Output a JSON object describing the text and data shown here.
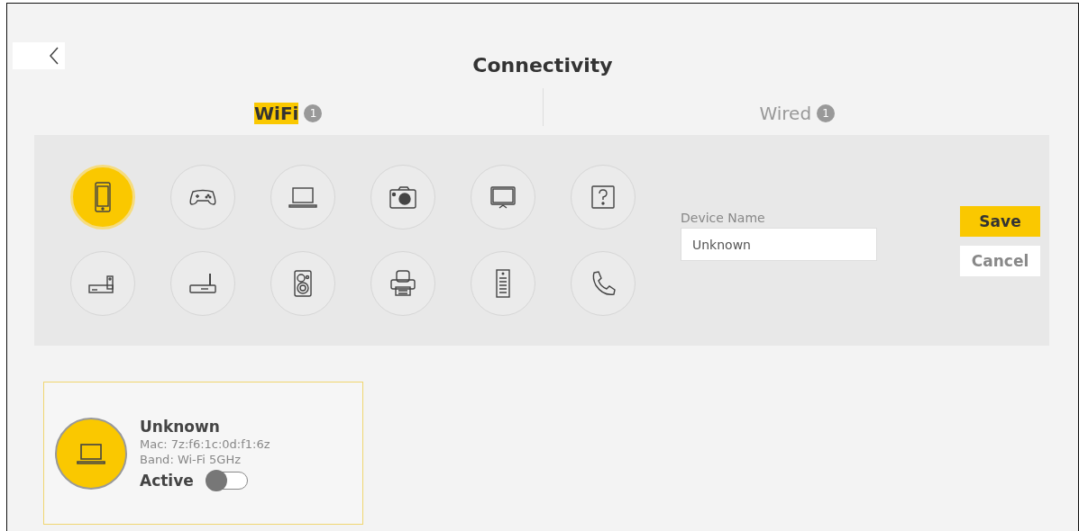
{
  "title": "Connectivity",
  "tabs": [
    {
      "label": "WiFi",
      "count": "1",
      "selected": true
    },
    {
      "label": "Wired",
      "count": "1",
      "selected": false
    }
  ],
  "device_types": [
    {
      "kind": "phone",
      "selected": true
    },
    {
      "kind": "gamepad",
      "selected": false
    },
    {
      "kind": "laptop",
      "selected": false
    },
    {
      "kind": "camera",
      "selected": false
    },
    {
      "kind": "tv",
      "selected": false
    },
    {
      "kind": "unknown",
      "selected": false
    },
    {
      "kind": "settopbox",
      "selected": false
    },
    {
      "kind": "router",
      "selected": false
    },
    {
      "kind": "speaker",
      "selected": false
    },
    {
      "kind": "printer",
      "selected": false
    },
    {
      "kind": "server",
      "selected": false
    },
    {
      "kind": "telephone",
      "selected": false
    }
  ],
  "device_name": {
    "label": "Device Name",
    "value": "Unknown"
  },
  "buttons": [
    {
      "label": "Save",
      "kind": "primary"
    },
    {
      "label": "Cancel",
      "kind": "secondary"
    }
  ],
  "devices": [
    {
      "kind": "laptop",
      "name": "Unknown",
      "mac": "Mac: 7z:f6:1c:0d:f1:6z",
      "band": "Band: Wi-Fi 5GHz",
      "active_label": "Active",
      "active": false
    }
  ]
}
